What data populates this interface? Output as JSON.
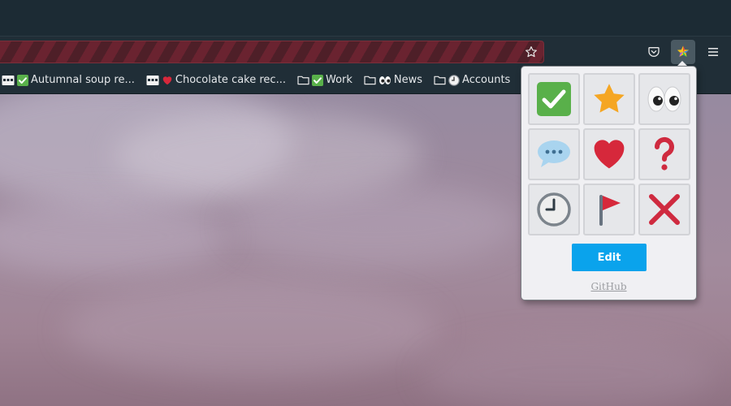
{
  "navbar": {
    "bookmark_star_icon": "star-outline-icon",
    "pocket_icon": "pocket-icon",
    "extension_icon": "emoji-bookmarks-extension-icon",
    "menu_icon": "hamburger-menu-icon"
  },
  "bookmarks": [
    {
      "icon": "note-icon",
      "emoji_icon": "check-mark-icon",
      "label": "Autumnal soup re..."
    },
    {
      "icon": "note-icon",
      "emoji_icon": "red-heart-icon",
      "label": "Chocolate cake rec..."
    },
    {
      "icon": "folder-icon",
      "emoji_icon": "check-mark-icon",
      "label": "Work"
    },
    {
      "icon": "folder-icon",
      "emoji_icon": "eyes-icon",
      "label": "News"
    },
    {
      "icon": "folder-icon",
      "emoji_icon": "clock-icon",
      "label": "Accounts"
    }
  ],
  "popup": {
    "emoji_grid": [
      "check-mark",
      "star",
      "eyes",
      "speech-bubble",
      "red-heart",
      "question-mark",
      "clock",
      "red-flag",
      "cross-mark"
    ],
    "edit_label": "Edit",
    "github_label": "GitHub"
  },
  "colors": {
    "chrome_bg": "#1c2b34",
    "toolbar_bg": "#202e37",
    "urlbar_stripe_a": "#6a2330",
    "urlbar_stripe_b": "#4e1f28",
    "edit_button": "#0aa3ec"
  }
}
